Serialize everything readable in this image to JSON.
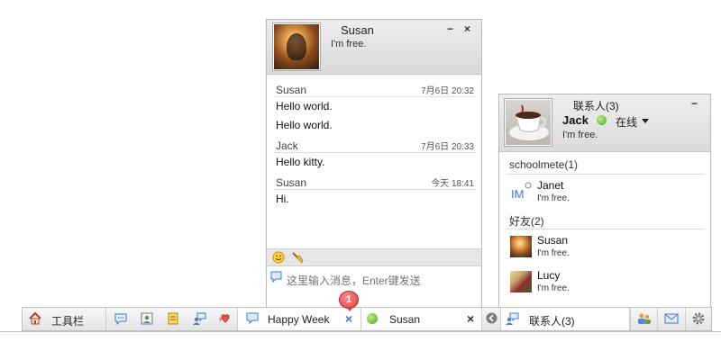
{
  "chat": {
    "title": "Susan",
    "status": "I'm free.",
    "minimize_label": "−",
    "close_label": "×",
    "messages": [
      {
        "sender": "Susan",
        "time": "7月6日 20:32",
        "lines": [
          "Hello world.",
          "Hello world."
        ]
      },
      {
        "sender": "Jack",
        "time": "7月6日 20:33",
        "lines": [
          "Hello kitty."
        ]
      },
      {
        "sender": "Susan",
        "time": "今天 18:41",
        "lines": [
          "Hi."
        ]
      }
    ],
    "toolbar": {
      "emoji_icon": "smiley-icon",
      "clear_icon": "broom-icon"
    },
    "input_placeholder": "这里输入消息，Enter键发送"
  },
  "contacts": {
    "title": "联系人(3)",
    "minimize_label": "−",
    "me": {
      "name": "Jack",
      "presence": "在线",
      "status": "I'm free."
    },
    "groups": [
      {
        "title": "schoolmete(1)",
        "items": [
          {
            "name": "Janet",
            "status": "I'm free.",
            "avatar": "im-logo-icon"
          }
        ]
      },
      {
        "title": "好友(2)",
        "items": [
          {
            "name": "Susan",
            "status": "I'm free.",
            "avatar": "susan-avatar"
          },
          {
            "name": "Lucy",
            "status": "I'm free.",
            "avatar": "lucy-avatar"
          }
        ]
      }
    ]
  },
  "taskbar": {
    "toolbar_label": "工具栏",
    "tab_happy_week": "Happy Week",
    "tab_susan": "Susan",
    "contacts_label": "联系人(3)",
    "badge_count": "1",
    "close_label": "×"
  },
  "colors": {
    "online_green": "#4aa71c",
    "badge_red": "#d83a3a",
    "accent_blue": "#3a7ad8"
  }
}
